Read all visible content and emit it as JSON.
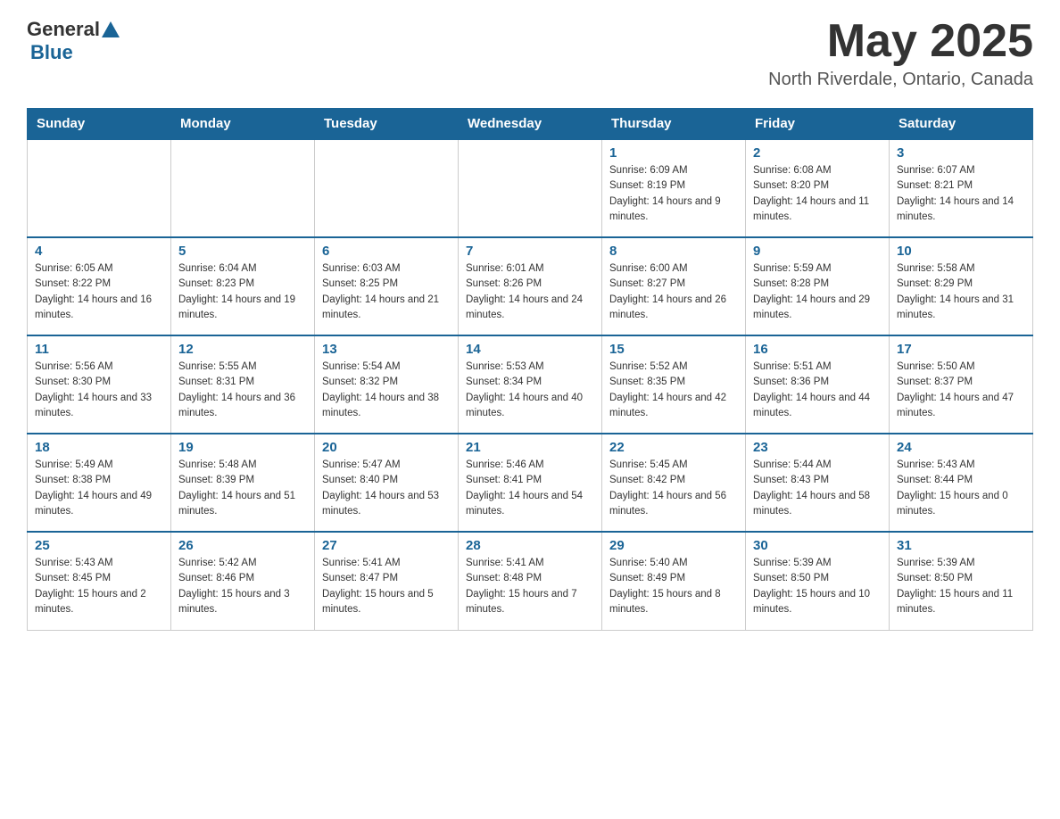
{
  "header": {
    "logo_general": "General",
    "logo_blue": "Blue",
    "month_title": "May 2025",
    "location": "North Riverdale, Ontario, Canada"
  },
  "days_of_week": [
    "Sunday",
    "Monday",
    "Tuesday",
    "Wednesday",
    "Thursday",
    "Friday",
    "Saturday"
  ],
  "weeks": [
    [
      {
        "day": "",
        "info": ""
      },
      {
        "day": "",
        "info": ""
      },
      {
        "day": "",
        "info": ""
      },
      {
        "day": "",
        "info": ""
      },
      {
        "day": "1",
        "info": "Sunrise: 6:09 AM\nSunset: 8:19 PM\nDaylight: 14 hours and 9 minutes."
      },
      {
        "day": "2",
        "info": "Sunrise: 6:08 AM\nSunset: 8:20 PM\nDaylight: 14 hours and 11 minutes."
      },
      {
        "day": "3",
        "info": "Sunrise: 6:07 AM\nSunset: 8:21 PM\nDaylight: 14 hours and 14 minutes."
      }
    ],
    [
      {
        "day": "4",
        "info": "Sunrise: 6:05 AM\nSunset: 8:22 PM\nDaylight: 14 hours and 16 minutes."
      },
      {
        "day": "5",
        "info": "Sunrise: 6:04 AM\nSunset: 8:23 PM\nDaylight: 14 hours and 19 minutes."
      },
      {
        "day": "6",
        "info": "Sunrise: 6:03 AM\nSunset: 8:25 PM\nDaylight: 14 hours and 21 minutes."
      },
      {
        "day": "7",
        "info": "Sunrise: 6:01 AM\nSunset: 8:26 PM\nDaylight: 14 hours and 24 minutes."
      },
      {
        "day": "8",
        "info": "Sunrise: 6:00 AM\nSunset: 8:27 PM\nDaylight: 14 hours and 26 minutes."
      },
      {
        "day": "9",
        "info": "Sunrise: 5:59 AM\nSunset: 8:28 PM\nDaylight: 14 hours and 29 minutes."
      },
      {
        "day": "10",
        "info": "Sunrise: 5:58 AM\nSunset: 8:29 PM\nDaylight: 14 hours and 31 minutes."
      }
    ],
    [
      {
        "day": "11",
        "info": "Sunrise: 5:56 AM\nSunset: 8:30 PM\nDaylight: 14 hours and 33 minutes."
      },
      {
        "day": "12",
        "info": "Sunrise: 5:55 AM\nSunset: 8:31 PM\nDaylight: 14 hours and 36 minutes."
      },
      {
        "day": "13",
        "info": "Sunrise: 5:54 AM\nSunset: 8:32 PM\nDaylight: 14 hours and 38 minutes."
      },
      {
        "day": "14",
        "info": "Sunrise: 5:53 AM\nSunset: 8:34 PM\nDaylight: 14 hours and 40 minutes."
      },
      {
        "day": "15",
        "info": "Sunrise: 5:52 AM\nSunset: 8:35 PM\nDaylight: 14 hours and 42 minutes."
      },
      {
        "day": "16",
        "info": "Sunrise: 5:51 AM\nSunset: 8:36 PM\nDaylight: 14 hours and 44 minutes."
      },
      {
        "day": "17",
        "info": "Sunrise: 5:50 AM\nSunset: 8:37 PM\nDaylight: 14 hours and 47 minutes."
      }
    ],
    [
      {
        "day": "18",
        "info": "Sunrise: 5:49 AM\nSunset: 8:38 PM\nDaylight: 14 hours and 49 minutes."
      },
      {
        "day": "19",
        "info": "Sunrise: 5:48 AM\nSunset: 8:39 PM\nDaylight: 14 hours and 51 minutes."
      },
      {
        "day": "20",
        "info": "Sunrise: 5:47 AM\nSunset: 8:40 PM\nDaylight: 14 hours and 53 minutes."
      },
      {
        "day": "21",
        "info": "Sunrise: 5:46 AM\nSunset: 8:41 PM\nDaylight: 14 hours and 54 minutes."
      },
      {
        "day": "22",
        "info": "Sunrise: 5:45 AM\nSunset: 8:42 PM\nDaylight: 14 hours and 56 minutes."
      },
      {
        "day": "23",
        "info": "Sunrise: 5:44 AM\nSunset: 8:43 PM\nDaylight: 14 hours and 58 minutes."
      },
      {
        "day": "24",
        "info": "Sunrise: 5:43 AM\nSunset: 8:44 PM\nDaylight: 15 hours and 0 minutes."
      }
    ],
    [
      {
        "day": "25",
        "info": "Sunrise: 5:43 AM\nSunset: 8:45 PM\nDaylight: 15 hours and 2 minutes."
      },
      {
        "day": "26",
        "info": "Sunrise: 5:42 AM\nSunset: 8:46 PM\nDaylight: 15 hours and 3 minutes."
      },
      {
        "day": "27",
        "info": "Sunrise: 5:41 AM\nSunset: 8:47 PM\nDaylight: 15 hours and 5 minutes."
      },
      {
        "day": "28",
        "info": "Sunrise: 5:41 AM\nSunset: 8:48 PM\nDaylight: 15 hours and 7 minutes."
      },
      {
        "day": "29",
        "info": "Sunrise: 5:40 AM\nSunset: 8:49 PM\nDaylight: 15 hours and 8 minutes."
      },
      {
        "day": "30",
        "info": "Sunrise: 5:39 AM\nSunset: 8:50 PM\nDaylight: 15 hours and 10 minutes."
      },
      {
        "day": "31",
        "info": "Sunrise: 5:39 AM\nSunset: 8:50 PM\nDaylight: 15 hours and 11 minutes."
      }
    ]
  ]
}
